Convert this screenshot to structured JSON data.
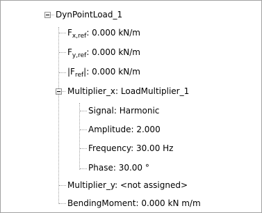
{
  "tree": {
    "root": {
      "label": "DynPointLoad_1",
      "expanded": true
    },
    "fx": {
      "symbol": "F",
      "subscript": "x,ref",
      "value": ": 0.000 kN/m"
    },
    "fy": {
      "symbol": "F",
      "subscript": "y,ref",
      "value": ": 0.000 kN/m"
    },
    "fmag": {
      "prefix": "|F",
      "subscript": "ref",
      "value": "|: 0.000 kN/m"
    },
    "multiplier_x": {
      "label": "Multiplier_x: LoadMultiplier_1",
      "expanded": true,
      "children": {
        "signal": "Signal: Harmonic",
        "amplitude": "Amplitude: 2.000",
        "frequency": "Frequency: 30.00 Hz",
        "phase": "Phase: 30.00 °"
      }
    },
    "multiplier_y": "Multiplier_y: <not assigned>",
    "bending_moment": "BendingMoment: 0.000 kN m/m"
  },
  "icons": {
    "root_toggle": "collapse-minus-icon",
    "multiplier_x_toggle": "collapse-minus-icon"
  },
  "colors": {
    "border": "#a0a0a0",
    "tree_lines": "#a0a0a0",
    "text": "#000000",
    "background": "#ffffff"
  }
}
